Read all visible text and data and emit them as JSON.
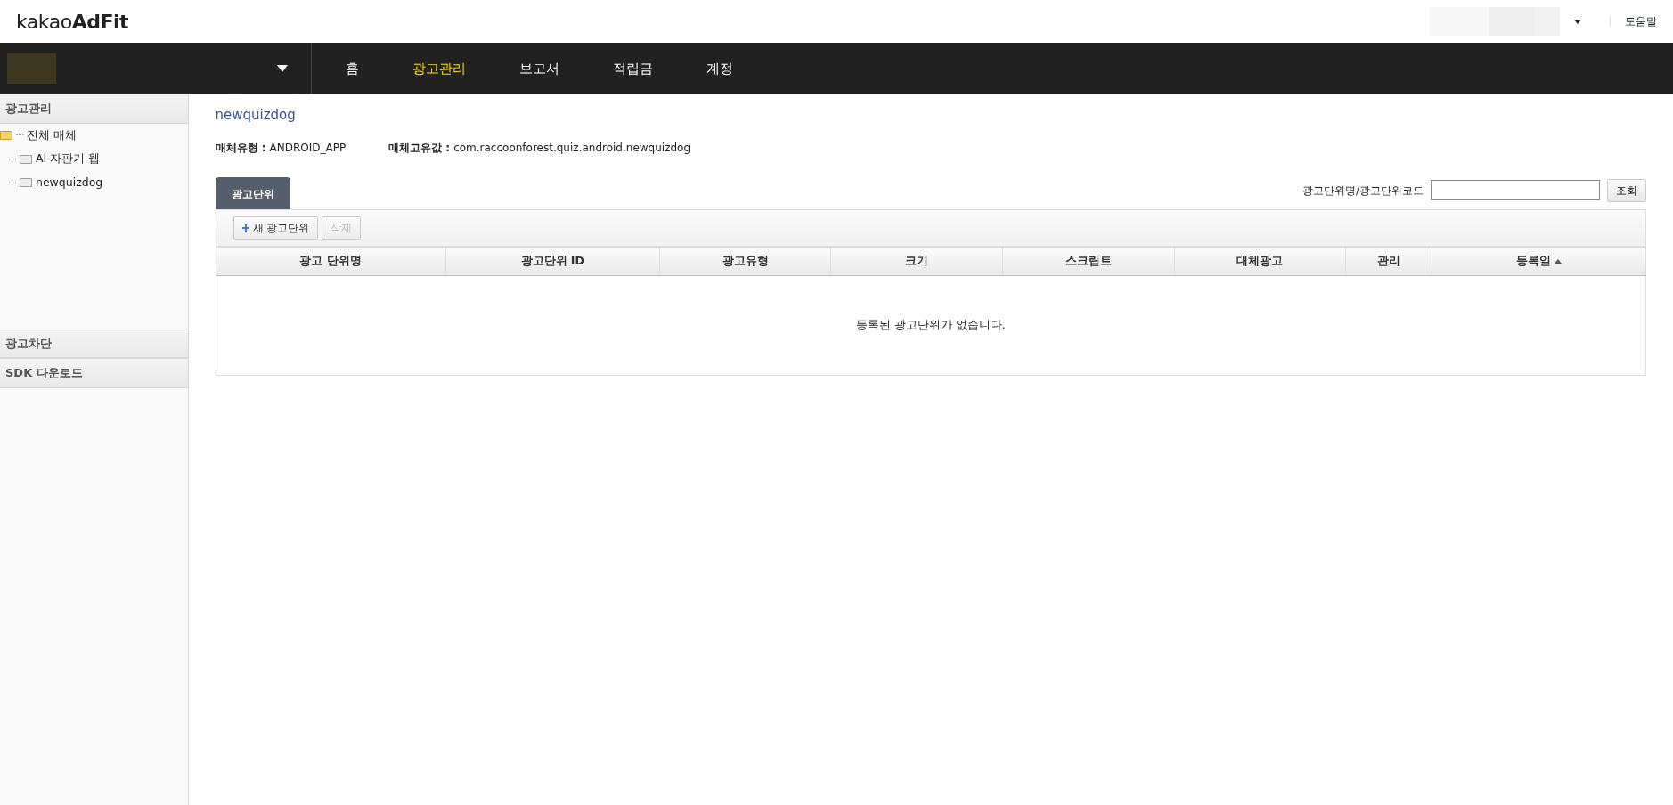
{
  "header": {
    "logo": "kakao**AdFit**",
    "help_link": "도움말"
  },
  "nav": {
    "items": [
      {
        "label": "홈",
        "selected": false
      },
      {
        "label": "광고관리",
        "selected": true
      },
      {
        "label": "보고서",
        "selected": false
      },
      {
        "label": "적립금",
        "selected": false
      },
      {
        "label": "계정",
        "selected": false
      }
    ]
  },
  "sidebar": {
    "sections": [
      {
        "title": "광고관리",
        "tree": [
          {
            "label": "전체 매체",
            "expanded": true,
            "children": [
              {
                "label": "AI 자판기 웹"
              },
              {
                "label": "newquizdog"
              }
            ]
          }
        ]
      },
      {
        "title": "광고차단"
      },
      {
        "title": "SDK 다운로드"
      }
    ]
  },
  "content": {
    "title": "newquizdog",
    "meta": [
      {
        "label": "매체유형 :",
        "value": "ANDROID_APP"
      },
      {
        "label": "매체고유값 :",
        "value": "com.raccoonforest.quiz.android.newquizdog"
      }
    ],
    "tabs": [
      {
        "label": "광고단위",
        "selected": true
      }
    ],
    "search": {
      "label": "광고단위명/광고단위코드",
      "button": "조회"
    },
    "toolbar": [
      {
        "label": "새 광고단위",
        "kind": "add",
        "disabled": false
      },
      {
        "label": "삭제",
        "kind": "plain",
        "disabled": true
      }
    ],
    "table": {
      "columns": [
        {
          "label": "광고 단위명",
          "sorted": false
        },
        {
          "label": "광고단위 ID",
          "sorted": false
        },
        {
          "label": "광고유형",
          "sorted": false
        },
        {
          "label": "크기",
          "sorted": false
        },
        {
          "label": "스크립트",
          "sorted": false
        },
        {
          "label": "대체광고",
          "sorted": false
        },
        {
          "label": "관리",
          "sorted": false
        },
        {
          "label": "등록일",
          "sorted": true
        }
      ],
      "empty_message": "등록된 광고단위가 없습니다."
    }
  }
}
